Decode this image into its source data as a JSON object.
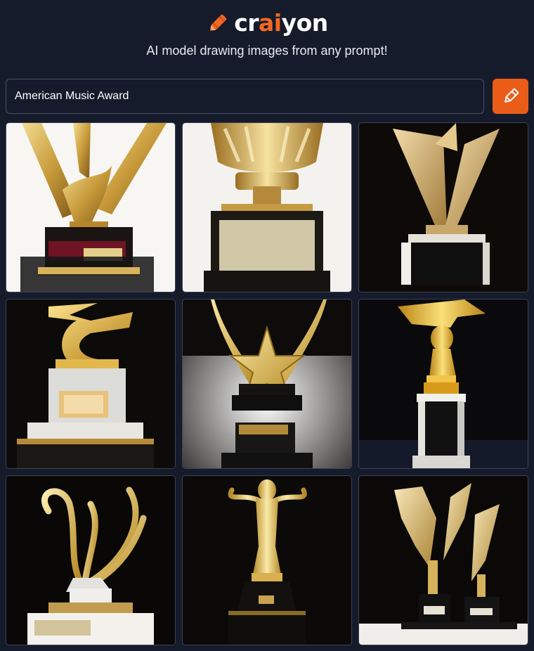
{
  "brand": {
    "name_prefix": "cr",
    "name_accent": "ai",
    "name_suffix": "yon",
    "accent_color": "#f26822",
    "icon": "crayon-icon"
  },
  "tagline": "AI model drawing images from any prompt!",
  "search": {
    "value": "American Music Award"
  },
  "draw_button": {
    "icon": "pencil-icon",
    "color": "#ea5d19"
  },
  "images": [
    {
      "id": 1
    },
    {
      "id": 2
    },
    {
      "id": 3
    },
    {
      "id": 4
    },
    {
      "id": 5
    },
    {
      "id": 6
    },
    {
      "id": 7
    },
    {
      "id": 8
    },
    {
      "id": 9
    }
  ],
  "theme": {
    "background": "#161b2c",
    "border": "#4a5163"
  }
}
